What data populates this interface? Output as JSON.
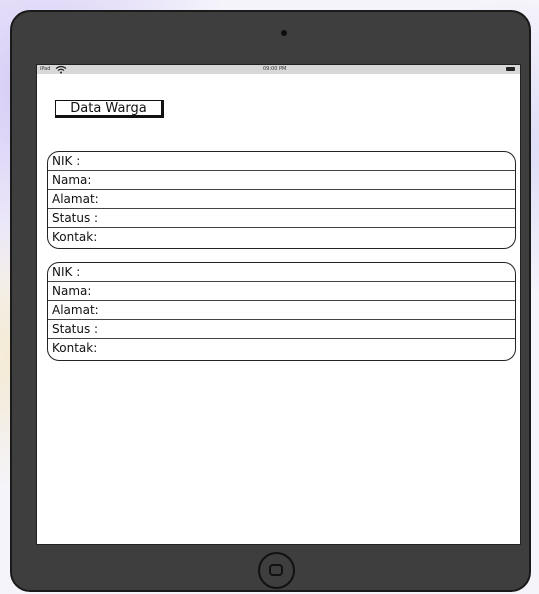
{
  "statusbar": {
    "carrier": "iPad",
    "time": "09:00 PM",
    "wifi_icon": "wifi-icon",
    "battery_icon": "battery-icon"
  },
  "header": {
    "title": "Data Warga"
  },
  "cards": [
    {
      "rows": [
        {
          "label": "NIK :"
        },
        {
          "label": "Nama:"
        },
        {
          "label": "Alamat:"
        },
        {
          "label": "Status :"
        },
        {
          "label": "Kontak:"
        }
      ]
    },
    {
      "rows": [
        {
          "label": "NIK :"
        },
        {
          "label": "Nama:"
        },
        {
          "label": "Alamat:"
        },
        {
          "label": "Status :"
        },
        {
          "label": "Kontak:"
        }
      ]
    }
  ],
  "device": {
    "home_icon": "home-button-icon",
    "camera_icon": "camera-icon"
  }
}
